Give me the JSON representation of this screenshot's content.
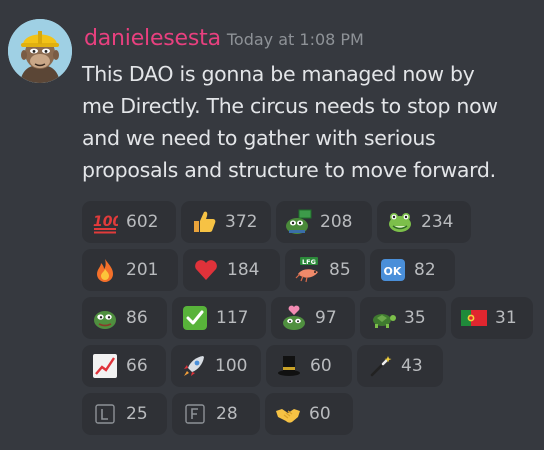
{
  "author": {
    "username": "danielesesta",
    "timestamp": "Today at 1:08 PM",
    "avatar_icon": "bored-ape-avatar"
  },
  "message": {
    "lines": [
      "This DAO is gonna be managed now by",
      "me Directly. The circus needs to stop now",
      "and we need to gather with serious",
      "proposals and structure to move forward."
    ]
  },
  "reactions": [
    {
      "icon": "hundred-points-icon",
      "count": "602"
    },
    {
      "icon": "thumbs-up-icon",
      "count": "372"
    },
    {
      "icon": "pepe-money-icon",
      "count": "208"
    },
    {
      "icon": "frog-face-icon",
      "count": "234"
    },
    {
      "icon": "fire-icon",
      "count": "201"
    },
    {
      "icon": "red-heart-icon",
      "count": "184"
    },
    {
      "icon": "lfg-shrimp-icon",
      "count": "85"
    },
    {
      "icon": "ok-button-icon",
      "count": "82"
    },
    {
      "icon": "pepe-icon",
      "count": "86"
    },
    {
      "icon": "check-mark-button-icon",
      "count": "117"
    },
    {
      "icon": "pepe-heart-icon",
      "count": "97"
    },
    {
      "icon": "turtle-icon",
      "count": "35"
    },
    {
      "icon": "portugal-flag-icon",
      "count": "31"
    },
    {
      "icon": "chart-increasing-icon",
      "count": "66"
    },
    {
      "icon": "rocket-icon",
      "count": "100"
    },
    {
      "icon": "top-hat-icon",
      "count": "60"
    },
    {
      "icon": "magic-wand-icon",
      "count": "43"
    },
    {
      "icon": "letter-l-icon",
      "count": "25"
    },
    {
      "icon": "letter-f-icon",
      "count": "28"
    },
    {
      "icon": "handshake-icon",
      "count": "60"
    }
  ],
  "colors": {
    "background": "#36393f",
    "reaction_bg": "#2f3136",
    "username": "#e8407f",
    "timestamp": "#8e9297",
    "text": "#e3e5e8"
  }
}
